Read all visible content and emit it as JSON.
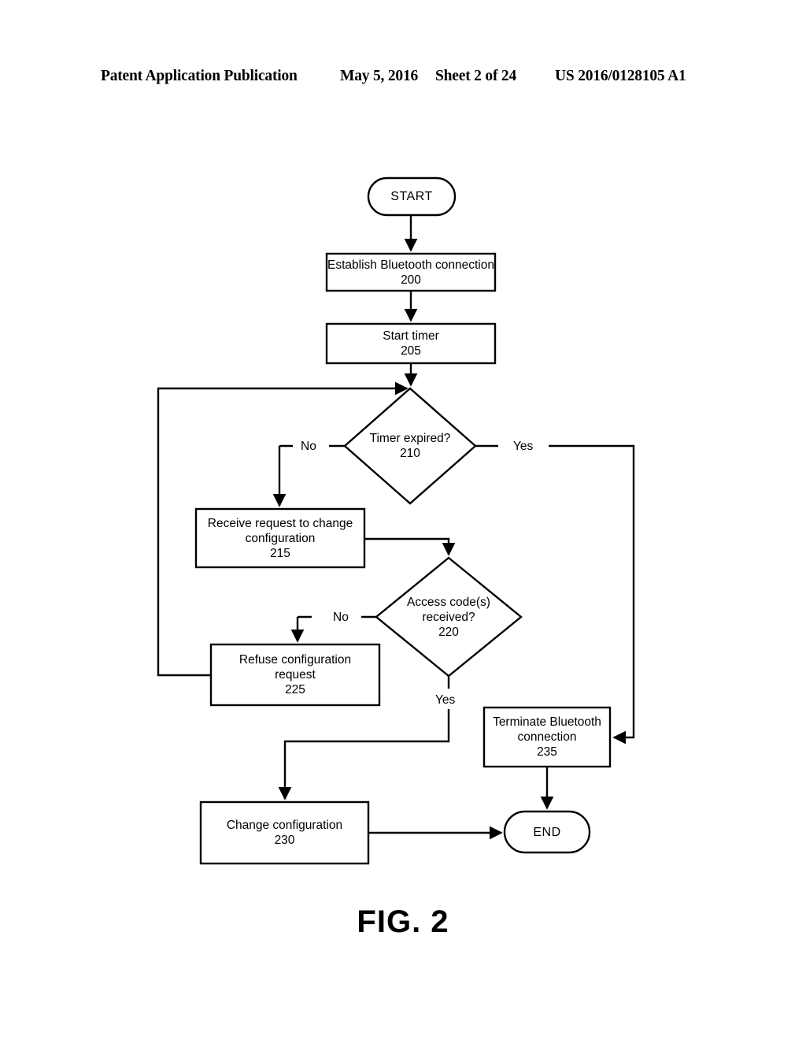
{
  "header": {
    "publication": "Patent Application Publication",
    "date": "May 5, 2016",
    "sheet": "Sheet 2 of 24",
    "patent_number": "US 2016/0128105 A1"
  },
  "figure": {
    "caption": "FIG. 2",
    "line_color": "#000000",
    "background_color": "#ffffff"
  },
  "flowchart": {
    "nodes": [
      {
        "id": "start",
        "shape": "terminator",
        "label": "START",
        "ref": ""
      },
      {
        "id": "n200",
        "shape": "process",
        "label": "Establish Bluetooth connection",
        "ref": "200"
      },
      {
        "id": "n205",
        "shape": "process",
        "label": "Start timer",
        "ref": "205"
      },
      {
        "id": "n210",
        "shape": "decision",
        "label": "Timer expired?",
        "ref": "210"
      },
      {
        "id": "n215",
        "shape": "process",
        "label": "Receive request to change\nconfiguration",
        "ref": "215"
      },
      {
        "id": "n220",
        "shape": "decision",
        "label": "Access code(s)\nreceived?",
        "ref": "220"
      },
      {
        "id": "n225",
        "shape": "process",
        "label": "Refuse configuration\nrequest",
        "ref": "225"
      },
      {
        "id": "n230",
        "shape": "process",
        "label": "Change configuration",
        "ref": "230"
      },
      {
        "id": "n235",
        "shape": "process",
        "label": "Terminate Bluetooth\nconnection",
        "ref": "235"
      },
      {
        "id": "end",
        "shape": "terminator",
        "label": "END",
        "ref": ""
      }
    ],
    "edges": [
      {
        "from": "start",
        "to": "n200",
        "label": ""
      },
      {
        "from": "n200",
        "to": "n205",
        "label": ""
      },
      {
        "from": "n205",
        "to": "n210",
        "label": ""
      },
      {
        "from": "n210",
        "to": "n215",
        "label": "No"
      },
      {
        "from": "n210",
        "to": "n235",
        "label": "Yes"
      },
      {
        "from": "n215",
        "to": "n220",
        "label": ""
      },
      {
        "from": "n220",
        "to": "n225",
        "label": "No"
      },
      {
        "from": "n220",
        "to": "n230",
        "label": "Yes"
      },
      {
        "from": "n225",
        "to": "n210",
        "label": ""
      },
      {
        "from": "n230",
        "to": "end",
        "label": ""
      },
      {
        "from": "n235",
        "to": "end",
        "label": ""
      }
    ],
    "edge_labels": {
      "timer_no": "No",
      "timer_yes": "Yes",
      "access_no": "No",
      "access_yes": "Yes"
    }
  }
}
